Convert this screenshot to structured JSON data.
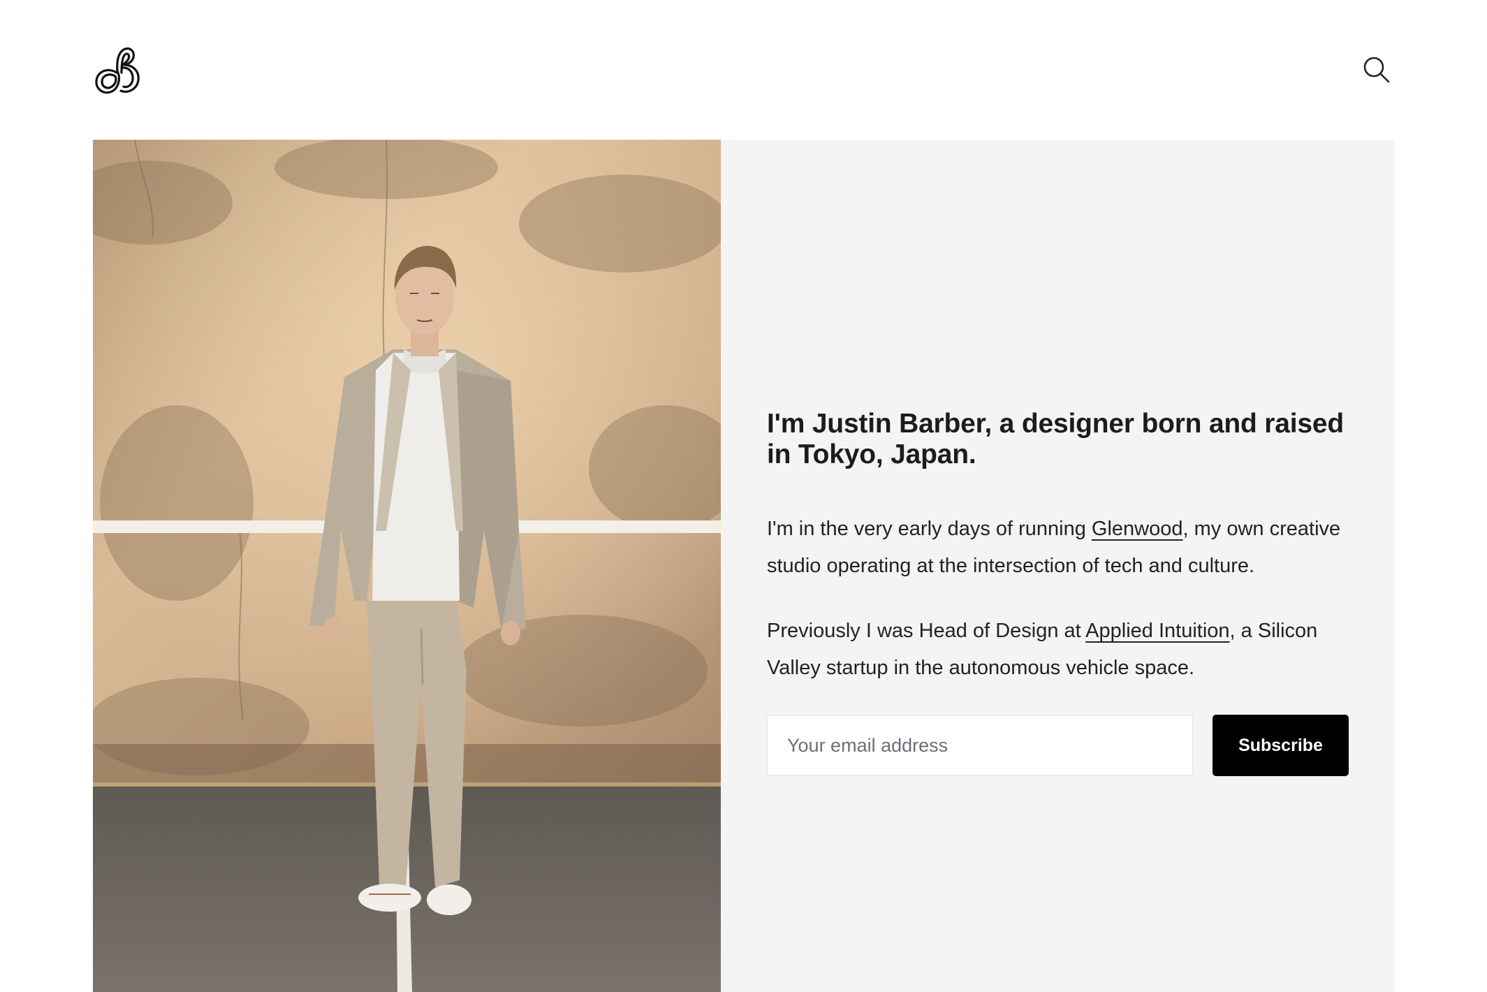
{
  "header": {
    "logo_alt": "JB monogram logo",
    "search_icon": "search-icon"
  },
  "photo": {
    "alt": "Portrait of Justin Barber standing against a sunlit wall"
  },
  "intro": {
    "headline": "I'm Justin Barber, a designer born and raised in Tokyo, Japan.",
    "para1_before": "I'm in the very early days of running ",
    "para1_link": "Glenwood",
    "para1_after": ", my own creative studio operating at the intersection of tech and culture.",
    "para2_before": "Previously I was Head of Design at ",
    "para2_link": "Applied Intuition",
    "para2_after": ", a Silicon Valley startup in the autonomous vehicle space."
  },
  "subscribe": {
    "placeholder": "Your email address",
    "button_label": "Subscribe"
  },
  "colors": {
    "panel_background": "#f4f4f4",
    "button_background": "#000000",
    "text": "#1a1a1a"
  }
}
